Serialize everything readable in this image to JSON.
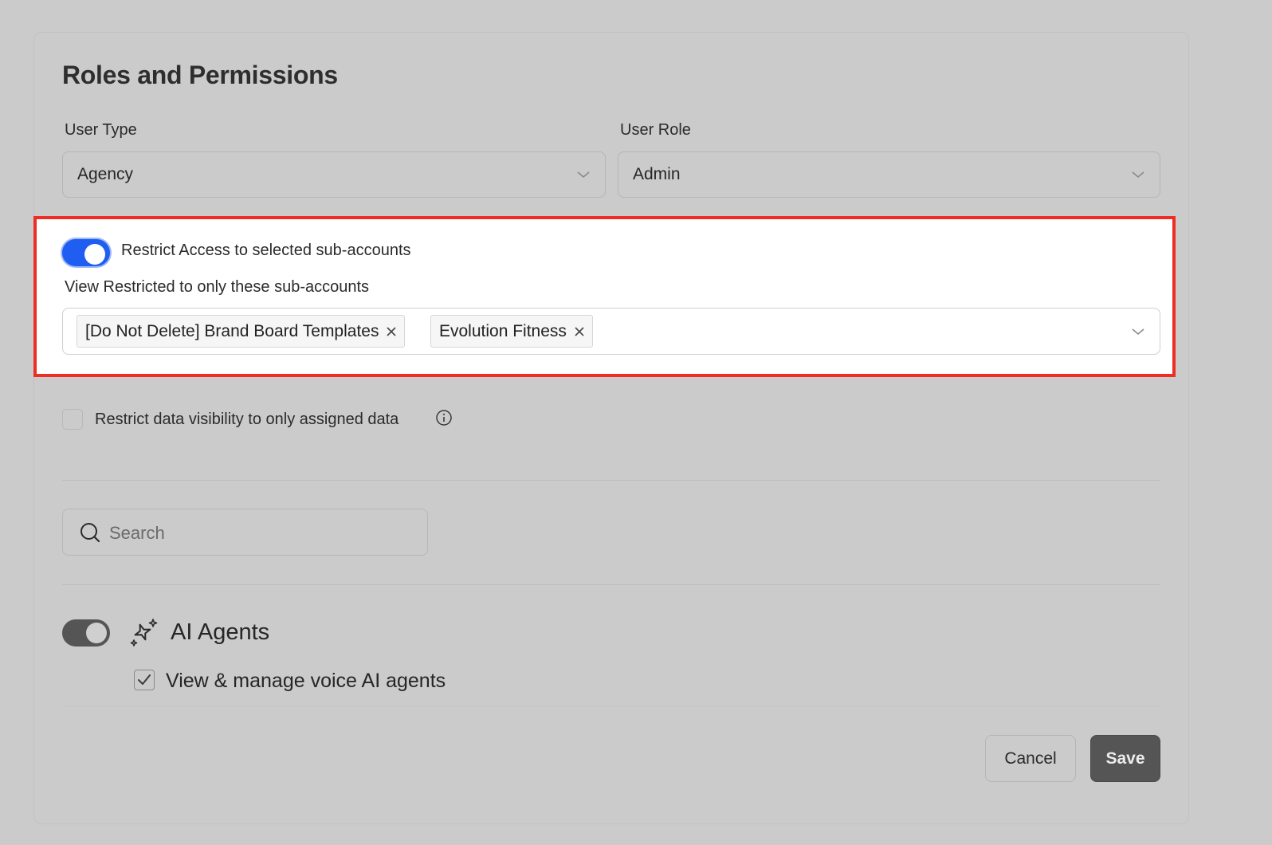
{
  "page": {
    "title": "Roles and Permissions"
  },
  "user_type": {
    "label": "User Type",
    "value": "Agency"
  },
  "user_role": {
    "label": "User Role",
    "value": "Admin"
  },
  "restrict_access": {
    "toggle_on": true,
    "label": "Restrict Access to selected sub-accounts",
    "view_label": "View Restricted to only these sub-accounts",
    "selected_tags": [
      "[Do Not Delete] Brand Board Templates",
      "Evolution Fitness"
    ]
  },
  "data_visibility": {
    "checked": false,
    "label": "Restrict data visibility to only assigned data",
    "info_icon": "info-circle-icon"
  },
  "search": {
    "placeholder": "Search",
    "value": ""
  },
  "ai_agents": {
    "toggle_on": true,
    "icon": "sparkles-icon",
    "title": "AI Agents",
    "permission_label": "View & manage voice AI agents",
    "permission_checked": true
  },
  "footer": {
    "cancel_label": "Cancel",
    "save_label": "Save"
  },
  "colors": {
    "toggle_active": "#1f5ef0",
    "highlight_border": "#ee2d25",
    "save_button": "#555555"
  }
}
